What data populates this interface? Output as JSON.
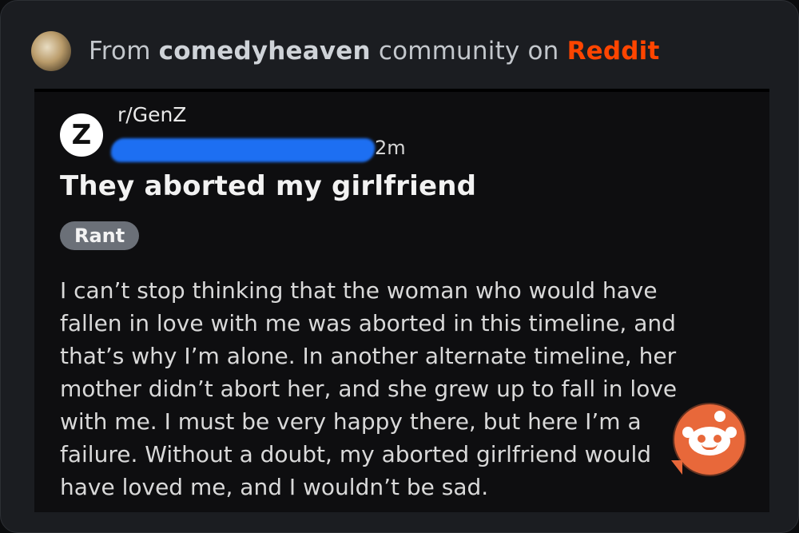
{
  "header": {
    "prefix": "From ",
    "community": "comedyheaven",
    "middle": " community on ",
    "platform": "Reddit"
  },
  "post": {
    "subreddit_icon_letter": "Z",
    "subreddit": "r/GenZ",
    "time": "2m",
    "title": "They aborted my girlfriend",
    "flair": "Rant",
    "body_lines": [
      "I can’t stop thinking that the woman who would have",
      "fallen in love with me was aborted in this timeline, and",
      "that’s why I’m alone. In another alternate timeline, her",
      "mother didn’t abort her, and she grew up to fall in love",
      "with me. I must be very happy there, but here I’m a",
      "failure. Without a doubt, my aborted girlfriend would",
      "have loved me, and I wouldn’t be sad."
    ]
  },
  "colors": {
    "accent": "#ff4500",
    "redaction": "#1d6ff2",
    "card_bg": "#1b1d21"
  },
  "icons": {
    "community_avatar": "avatar-icon",
    "subreddit_icon": "genz-logo-icon",
    "watermark": "reddit-snoo-icon"
  }
}
